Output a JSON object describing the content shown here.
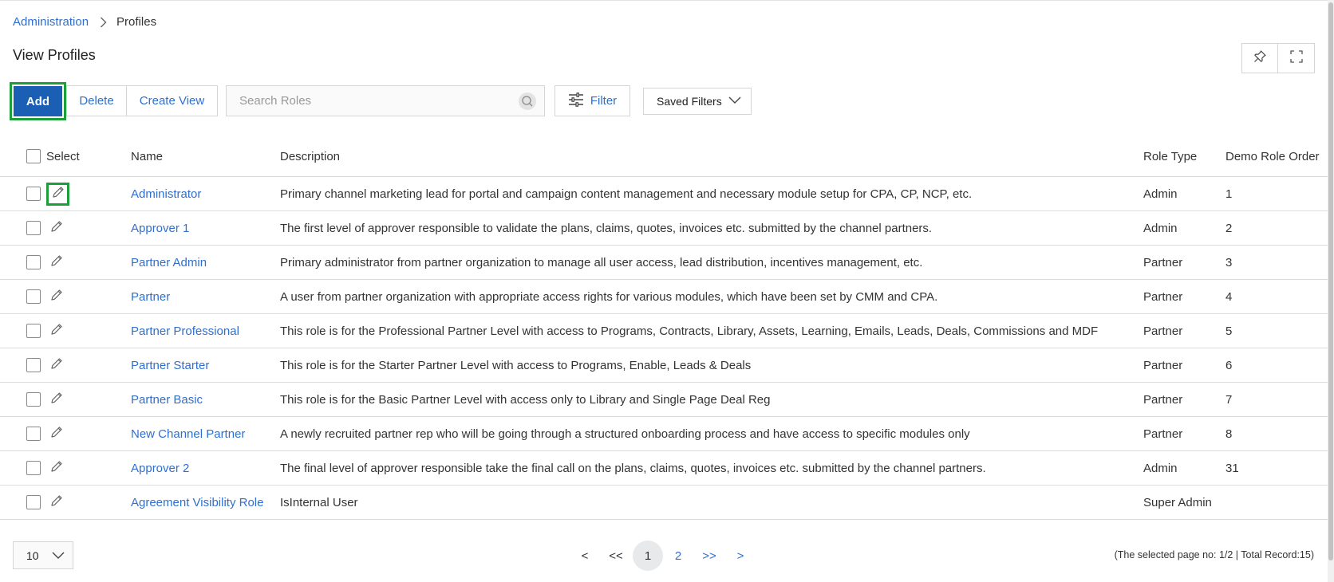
{
  "breadcrumb": {
    "parent": "Administration",
    "current": "Profiles"
  },
  "page": {
    "title": "View Profiles"
  },
  "toolbar": {
    "add_label": "Add",
    "delete_label": "Delete",
    "create_view_label": "Create View",
    "search_placeholder": "Search Roles",
    "search_value": "",
    "filter_label": "Filter",
    "saved_filters_label": "Saved Filters"
  },
  "table": {
    "headers": {
      "select": "Select",
      "name": "Name",
      "description": "Description",
      "role_type": "Role Type",
      "demo_role_order": "Demo Role Order"
    },
    "rows": [
      {
        "name": "Administrator",
        "description": "Primary channel marketing lead for portal and campaign content management and necessary module setup for CPA, CP, NCP, etc.",
        "role_type": "Admin",
        "order": "1"
      },
      {
        "name": "Approver 1",
        "description": "The first level of approver responsible to validate the plans, claims, quotes, invoices etc. submitted by the channel partners.",
        "role_type": "Admin",
        "order": "2"
      },
      {
        "name": "Partner Admin",
        "description": "Primary administrator from partner organization to manage all user access, lead distribution, incentives management, etc.",
        "role_type": "Partner",
        "order": "3"
      },
      {
        "name": "Partner",
        "description": "A user from partner organization with appropriate access rights for various modules, which have been set by CMM and CPA.",
        "role_type": "Partner",
        "order": "4"
      },
      {
        "name": "Partner Professional",
        "description": "This role is for the Professional Partner Level with access to Programs, Contracts, Library, Assets, Learning, Emails, Leads, Deals, Commissions and MDF",
        "role_type": "Partner",
        "order": "5"
      },
      {
        "name": "Partner Starter",
        "description": "This role is for the Starter Partner Level with access to Programs, Enable, Leads & Deals",
        "role_type": "Partner",
        "order": "6"
      },
      {
        "name": "Partner Basic",
        "description": "This role is for the Basic Partner Level with access only to Library and Single Page Deal Reg",
        "role_type": "Partner",
        "order": "7"
      },
      {
        "name": "New Channel Partner",
        "description": "A newly recruited partner rep who will be going through a structured onboarding process and have access to specific modules only",
        "role_type": "Partner",
        "order": "8"
      },
      {
        "name": "Approver 2",
        "description": "The final level of approver responsible take the final call on the plans, claims, quotes, invoices etc. submitted by the channel partners.",
        "role_type": "Admin",
        "order": "31"
      },
      {
        "name": "Agreement Visibility Role",
        "description": "IsInternal User",
        "role_type": "Super Admin",
        "order": ""
      }
    ]
  },
  "pagination": {
    "page_size": "10",
    "prev": "<",
    "first": "<<",
    "current_page": "1",
    "page_2": "2",
    "last": ">>",
    "next": ">",
    "info": "(The selected page no: 1/2 | Total Record:15)"
  },
  "colors": {
    "primary": "#1a5fb4",
    "link": "#2f6fd0",
    "highlight": "#1e9e3a"
  },
  "icons": [
    "chevron-right-icon",
    "pin-icon",
    "fullscreen-icon",
    "search-icon",
    "filter-sliders-icon",
    "chevron-down-icon",
    "pencil-icon"
  ]
}
